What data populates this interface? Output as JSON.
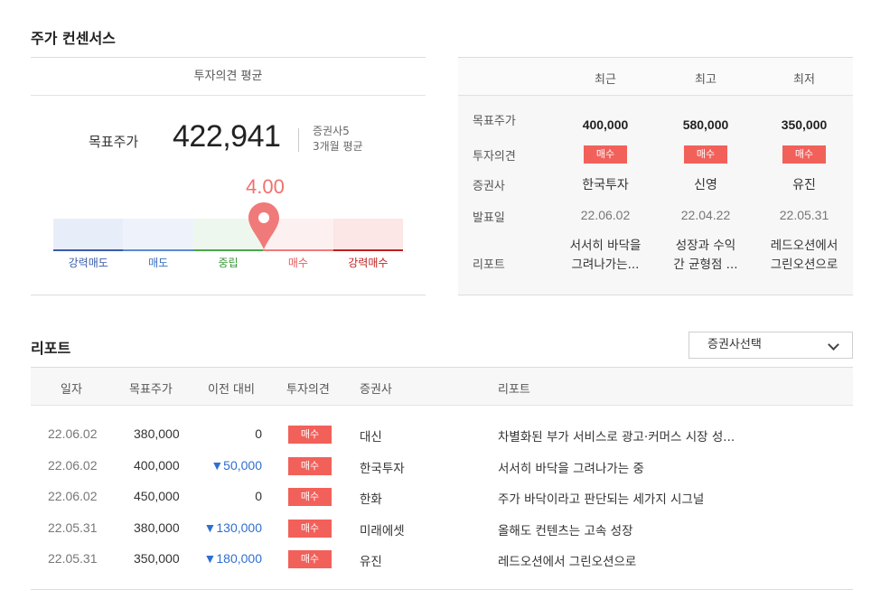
{
  "consensus": {
    "title": "주가 컨센서스",
    "panel_header": "투자의견 평균",
    "target_label": "목표주가",
    "target_value": "422,941",
    "meta_brokers": "증권사5",
    "meta_period": "3개월 평균",
    "score": "4.00",
    "score_fraction": 0.75,
    "scale": [
      {
        "label": "강력매도",
        "bg": "#e8eef9",
        "line": "#3a5ba8",
        "color": "#3a5ba8"
      },
      {
        "label": "매도",
        "bg": "#eef3fb",
        "line": "#5b8ad6",
        "color": "#3a6fc0"
      },
      {
        "label": "중립",
        "bg": "#eef7ee",
        "line": "#4aa64a",
        "color": "#3b9a3b"
      },
      {
        "label": "매수",
        "bg": "#fdf0f0",
        "line": "#f07a7a",
        "color": "#e85a5a"
      },
      {
        "label": "강력매수",
        "bg": "#fce6e6",
        "line": "#c02020",
        "color": "#c02020"
      }
    ],
    "pin_color": "#f07a7a"
  },
  "summary": {
    "columns": [
      "최근",
      "최고",
      "최저"
    ],
    "row_labels": {
      "target": "목표주가",
      "opinion": "투자의견",
      "broker": "증권사",
      "date": "발표일",
      "report": "리포트"
    },
    "cols": [
      {
        "target": "400,000",
        "opinion": "매수",
        "broker": "한국투자",
        "date": "22.06.02",
        "report_line1": "서서히 바닥을",
        "report_line2": "그려나가는..."
      },
      {
        "target": "580,000",
        "opinion": "매수",
        "broker": "신영",
        "date": "22.04.22",
        "report_line1": "성장과 수익",
        "report_line2": "간 균형점 ..."
      },
      {
        "target": "350,000",
        "opinion": "매수",
        "broker": "유진",
        "date": "22.05.31",
        "report_line1": "레드오션에서",
        "report_line2": "그린오션으로"
      }
    ]
  },
  "reports": {
    "title": "리포트",
    "select_label": "증권사선택",
    "headers": {
      "date": "일자",
      "target": "목표주가",
      "change": "이전 대비",
      "opinion": "투자의견",
      "broker": "증권사",
      "report": "리포트"
    },
    "rows": [
      {
        "date": "22.06.02",
        "target": "380,000",
        "change": "0",
        "change_dir": "flat",
        "opinion": "매수",
        "broker": "대신",
        "report": "차별화된 부가 서비스로 광고·커머스 시장 성..."
      },
      {
        "date": "22.06.02",
        "target": "400,000",
        "change": "▼50,000",
        "change_dir": "down",
        "opinion": "매수",
        "broker": "한국투자",
        "report": "서서히 바닥을 그려나가는 중"
      },
      {
        "date": "22.06.02",
        "target": "450,000",
        "change": "0",
        "change_dir": "flat",
        "opinion": "매수",
        "broker": "한화",
        "report": "주가 바닥이라고 판단되는 세가지 시그널"
      },
      {
        "date": "22.05.31",
        "target": "380,000",
        "change": "▼130,000",
        "change_dir": "down",
        "opinion": "매수",
        "broker": "미래에셋",
        "report": "올해도 컨텐츠는 고속 성장"
      },
      {
        "date": "22.05.31",
        "target": "350,000",
        "change": "▼180,000",
        "change_dir": "down",
        "opinion": "매수",
        "broker": "유진",
        "report": "레드오션에서 그린오션으로"
      }
    ]
  }
}
